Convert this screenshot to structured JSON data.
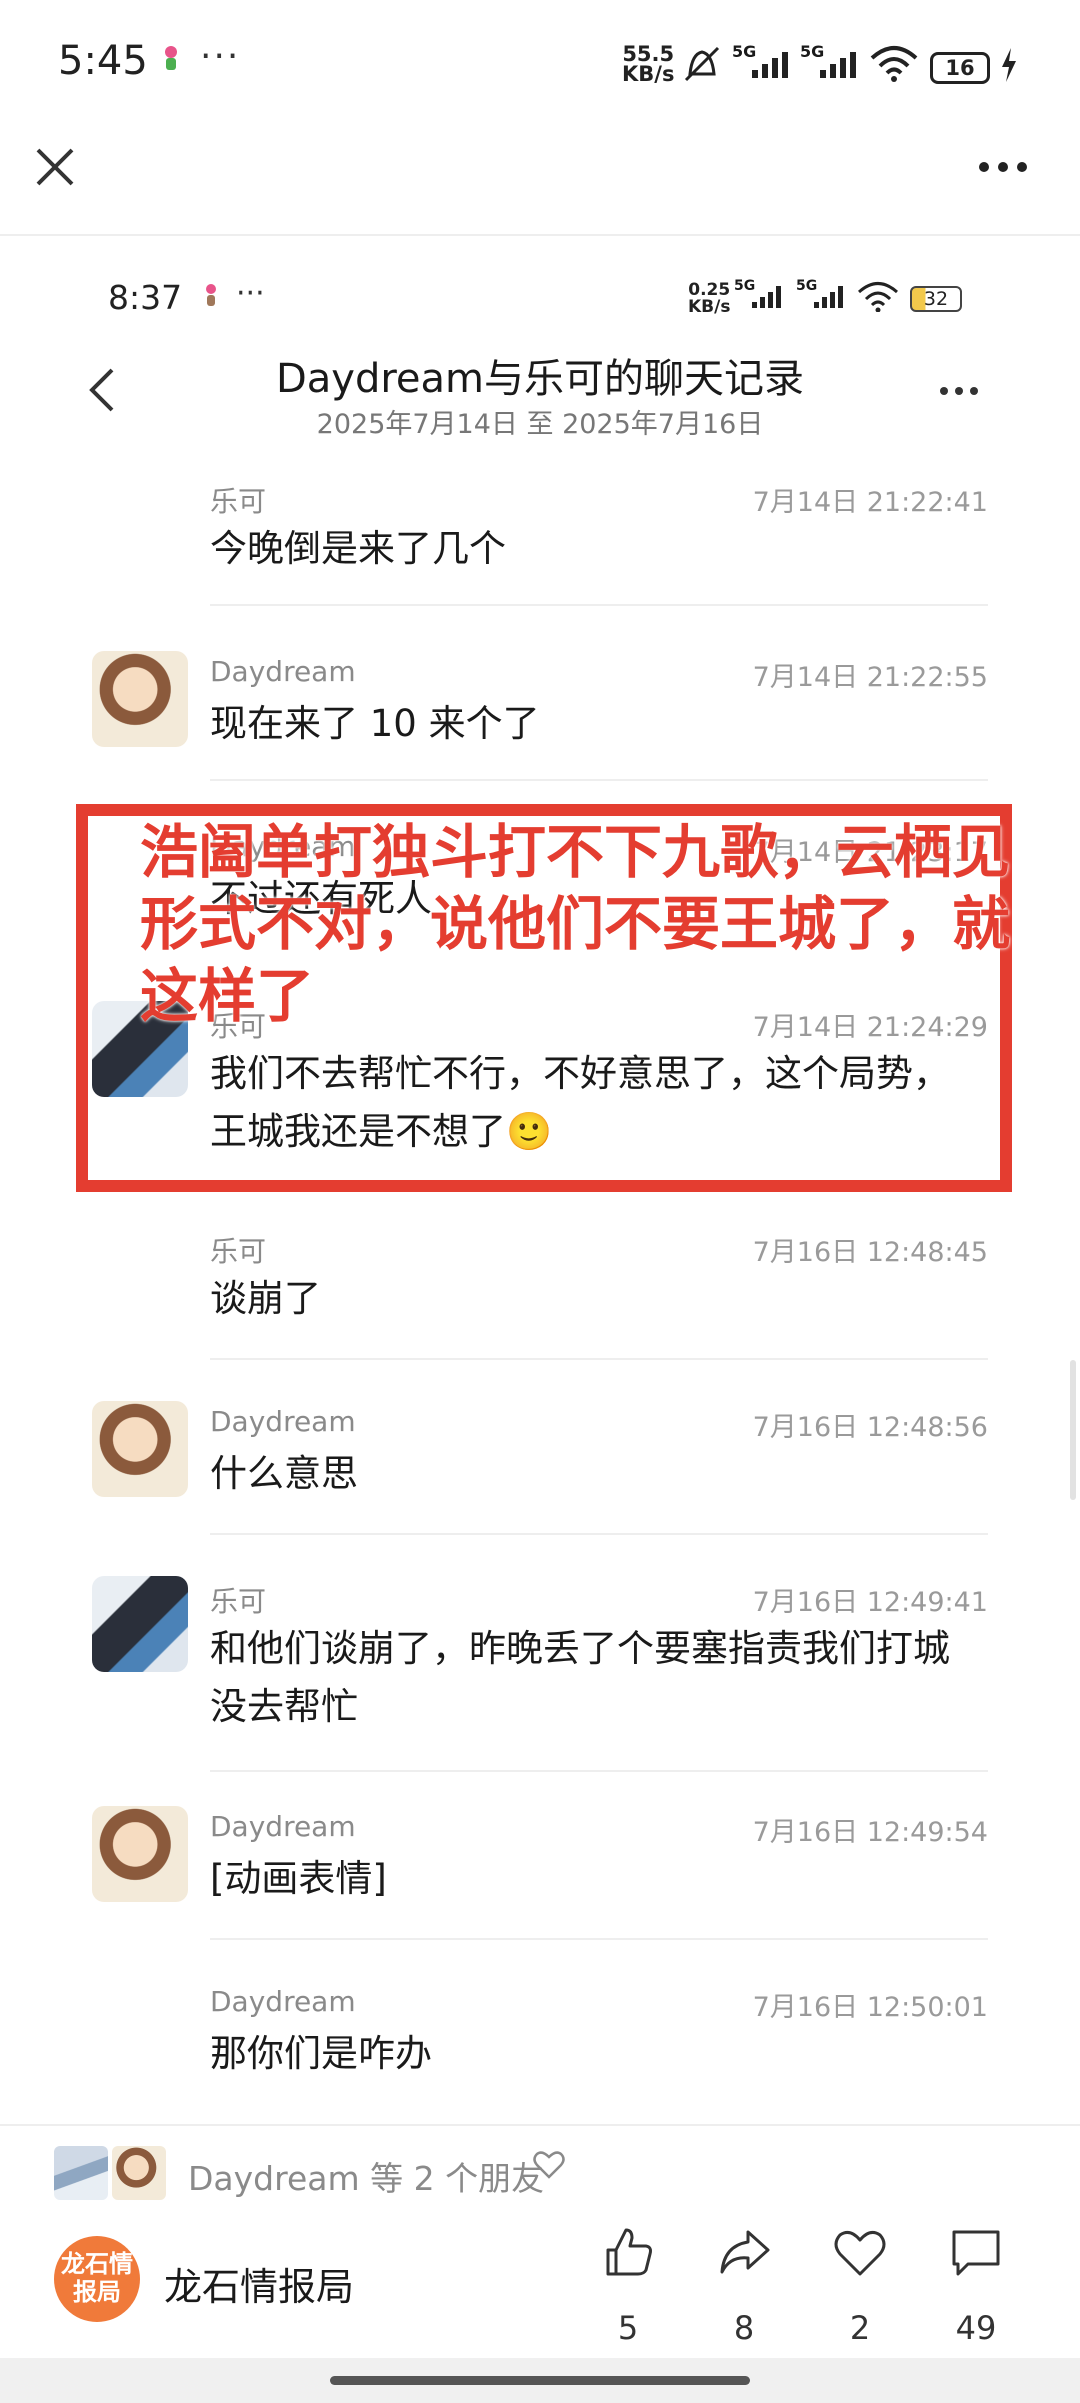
{
  "status_bar": {
    "time": "5:45",
    "dots": "···",
    "speed_value": "55.5",
    "speed_unit": "KB/s",
    "signal1": "5G",
    "signal2": "5G",
    "battery": "16"
  },
  "inner_status": {
    "time": "8:37",
    "dots": "···",
    "speed_value": "0.25",
    "speed_unit": "KB/s",
    "signal1": "5G",
    "signal2": "5G",
    "battery": "32"
  },
  "chat": {
    "title": "Daydream与乐可的聊天记录",
    "subtitle": "2025年7月14日 至 2025年7月16日",
    "messages": [
      {
        "sender": "乐可",
        "time": "7月14日 21:22:41",
        "text": "今晚倒是来了几个",
        "avatar": ""
      },
      {
        "sender": "Daydream",
        "time": "7月14日 21:22:55",
        "text": "现在来了 10 来个了",
        "avatar": "daydream-avatar"
      },
      {
        "sender": "Daydream",
        "time": "7月14日 21:23:17",
        "text": "不过还有死人",
        "avatar": ""
      },
      {
        "sender": "乐可",
        "time": "7月14日 21:24:29",
        "text": "我们不去帮忙不行，不好意思了，这个局势，王城我还是不想了🙂",
        "avatar": "leke-avatar"
      },
      {
        "sender": "乐可",
        "time": "7月16日 12:48:45",
        "text": "谈崩了",
        "avatar": ""
      },
      {
        "sender": "Daydream",
        "time": "7月16日 12:48:56",
        "text": "什么意思",
        "avatar": "daydream-avatar"
      },
      {
        "sender": "乐可",
        "time": "7月16日 12:49:41",
        "text": "和他们谈崩了，昨晚丢了个要塞指责我们打城没去帮忙",
        "avatar": "leke-avatar"
      },
      {
        "sender": "Daydream",
        "time": "7月16日 12:49:54",
        "text": "[动画表情]",
        "avatar": "daydream-avatar"
      },
      {
        "sender": "Daydream",
        "time": "7月16日 12:50:01",
        "text": "那你们是咋办",
        "avatar": ""
      }
    ]
  },
  "overlay": {
    "text": "浩阖单打独斗打不下九歌，云栖见形式不对，说他们不要王城了，就这样了",
    "color": "#e43d30"
  },
  "footer": {
    "likes_text": "Daydream 等 2 个朋友",
    "publisher_logo_text": "龙石情报局",
    "publisher_name": "龙石情报局",
    "actions": [
      {
        "icon": "thumbs-up-icon",
        "count": "5"
      },
      {
        "icon": "share-icon",
        "count": "8"
      },
      {
        "icon": "heart-icon",
        "count": "2"
      },
      {
        "icon": "comment-icon",
        "count": "49"
      }
    ]
  }
}
